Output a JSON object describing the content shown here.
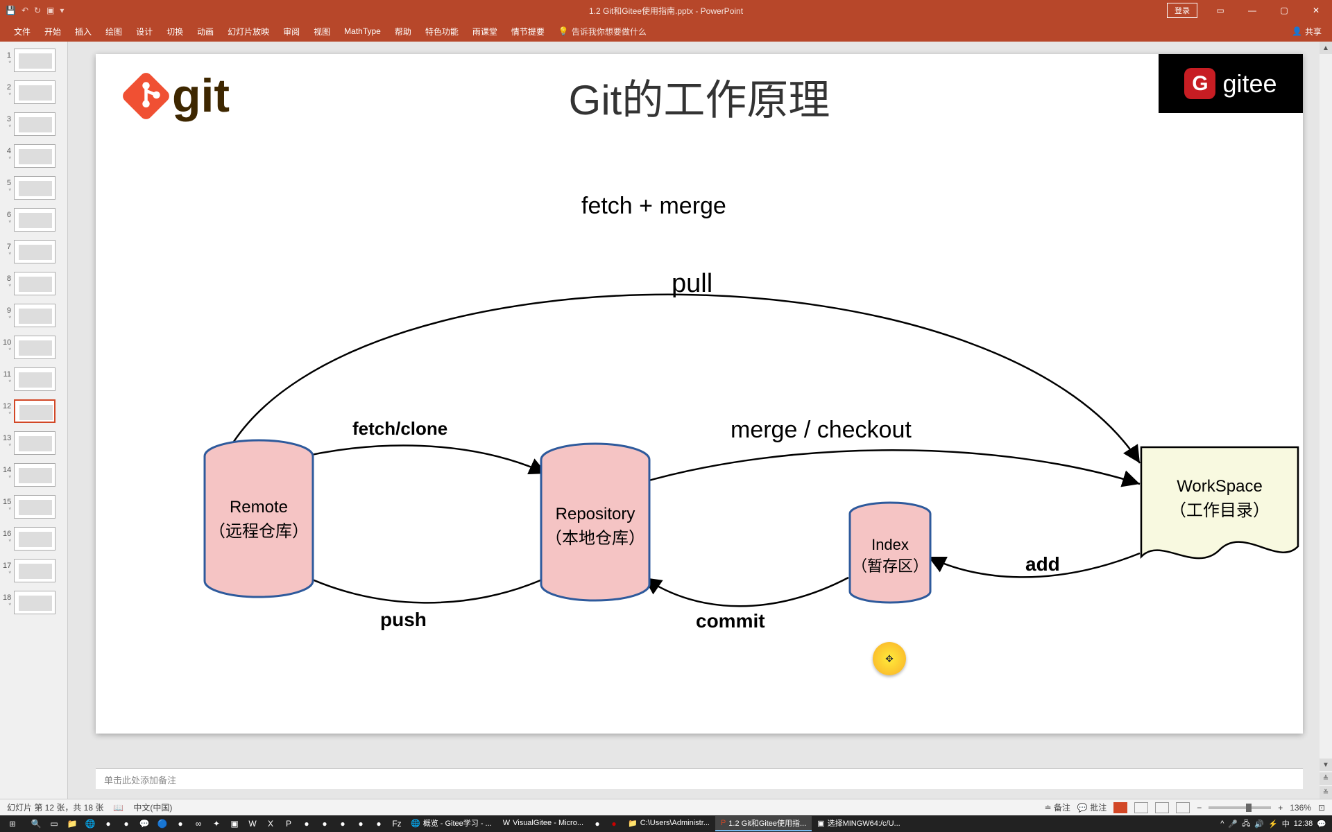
{
  "domain": "Diagram",
  "titlebar": {
    "title": "1.2 Git和Gitee使用指南.pptx - PowerPoint",
    "login": "登录"
  },
  "ribbon": {
    "tabs": [
      "文件",
      "开始",
      "插入",
      "绘图",
      "设计",
      "切换",
      "动画",
      "幻灯片放映",
      "审阅",
      "视图",
      "MathType",
      "帮助",
      "特色功能",
      "雨课堂",
      "情节提要"
    ],
    "tellme": "告诉我你想要做什么",
    "share": "共享"
  },
  "thumbs": {
    "count": 18,
    "active": 12
  },
  "slide": {
    "git_logo_text": "git",
    "title": "Git的工作原理",
    "gitee_logo_text": "gitee",
    "remote": {
      "name": "Remote",
      "sub": "（远程仓库）"
    },
    "repository": {
      "name": "Repository",
      "sub": "（本地仓库）"
    },
    "index": {
      "name": "Index",
      "sub": "（暂存区）"
    },
    "workspace": {
      "name": "WorkSpace",
      "sub": "（工作目录）"
    },
    "labels": {
      "fetch_merge": "fetch + merge",
      "pull": "pull",
      "fetch_clone": "fetch/clone",
      "merge_checkout": "merge / checkout",
      "push": "push",
      "commit": "commit",
      "add": "add"
    }
  },
  "notes": {
    "placeholder": "单击此处添加备注"
  },
  "statusbar": {
    "slide_info": "幻灯片 第 12 张，共 18 张",
    "lang": "中文(中国)",
    "notes": "备注",
    "comments": "批注",
    "zoom": "136%"
  },
  "taskbar": {
    "apps": [
      {
        "label": "概览 - Gitee学习 - ..."
      },
      {
        "label": "VisualGitee - Micro..."
      },
      {
        "label": "C:\\Users\\Administr..."
      },
      {
        "label": "1.2 Git和Gitee使用指..."
      },
      {
        "label": "选择MINGW64:/c/U..."
      }
    ],
    "ime": "中",
    "time": "12:38"
  },
  "chart_data": {
    "type": "diagram",
    "title": "Git的工作原理",
    "nodes": [
      {
        "id": "remote",
        "label": "Remote（远程仓库）",
        "shape": "cylinder"
      },
      {
        "id": "repository",
        "label": "Repository（本地仓库）",
        "shape": "cylinder"
      },
      {
        "id": "index",
        "label": "Index（暂存区）",
        "shape": "cylinder"
      },
      {
        "id": "workspace",
        "label": "WorkSpace（工作目录）",
        "shape": "document"
      }
    ],
    "edges": [
      {
        "from": "remote",
        "to": "workspace",
        "label": "pull"
      },
      {
        "from": "remote",
        "to": "workspace",
        "label": "fetch + merge"
      },
      {
        "from": "remote",
        "to": "repository",
        "label": "fetch/clone"
      },
      {
        "from": "repository",
        "to": "workspace",
        "label": "merge / checkout"
      },
      {
        "from": "workspace",
        "to": "index",
        "label": "add"
      },
      {
        "from": "index",
        "to": "repository",
        "label": "commit"
      },
      {
        "from": "repository",
        "to": "remote",
        "label": "push"
      }
    ]
  }
}
